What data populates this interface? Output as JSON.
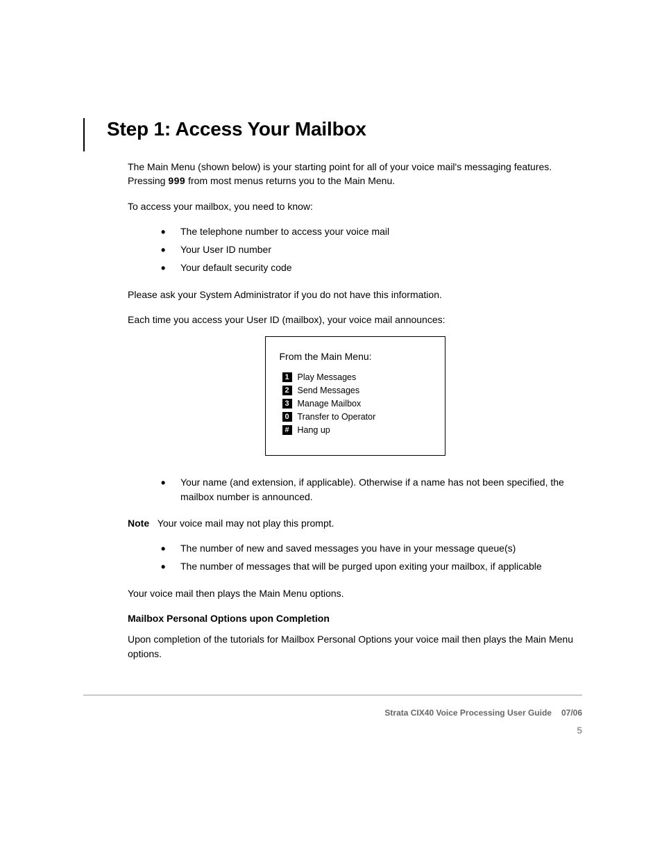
{
  "heading": "Step 1:  Access Your Mailbox",
  "para1_pre": "The Main Menu (shown below) is your starting point for all of your voice mail's messaging features. Pressing ",
  "key999": "999",
  "para1_post": " from most menus returns you to the Main Menu.",
  "para2": "To access your mailbox, you need to know:",
  "access_bullets": [
    "The telephone number to access your voice mail",
    "Your User ID number",
    "Your default security code"
  ],
  "para3": "Please ask your System Administrator if you do not have this information.",
  "tutorial_intro": "Each time you access your User ID (mailbox), your voice mail announces:",
  "box": {
    "title": "From the Main Menu:",
    "items": [
      {
        "key": "1",
        "label": "Play Messages"
      },
      {
        "key": "2",
        "label": "Send Messages"
      },
      {
        "key": "3",
        "label": "Manage Mailbox"
      },
      {
        "key": "0",
        "label": "Transfer to Operator"
      },
      {
        "key": "#",
        "label": "Hang up"
      }
    ]
  },
  "announce_bullets_1": [
    "Your name (and extension, if applicable). Otherwise if a name has not been specified, the mailbox number is announced."
  ],
  "note_label": "Note",
  "note_body": "Your voice mail may not play this prompt.",
  "announce_bullets_2": [
    "The number of new and saved messages you have in your message queue(s)",
    "The number of messages that will be purged upon exiting your mailbox, if applicable"
  ],
  "closing": "Your voice mail then plays the Main Menu options.",
  "completion_heading": "Mailbox Personal Options upon Completion",
  "completion_body": "Upon completion of the tutorials for Mailbox Personal Options your voice mail then plays the Main Menu options.",
  "footer_title": "Strata CIX40 Voice Processing User Guide",
  "footer_date": "07/06",
  "page_number": "5"
}
